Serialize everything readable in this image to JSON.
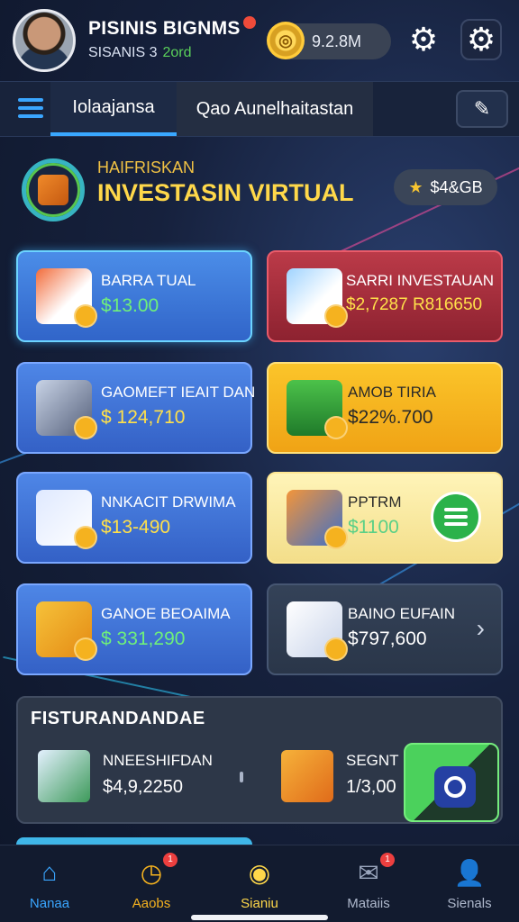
{
  "header": {
    "user_name": "PISINIS BIGNMS",
    "user_sub": "SISANIS 3",
    "user_sub_highlight": "2ord",
    "coin_value": "9.2.8M"
  },
  "tabs": {
    "tab_active": "Iolaajansa",
    "tab_second": "Qao Aunelhaitastan"
  },
  "hero": {
    "kicker": "HAIFRISKAN",
    "title": "INVESTASIN VIRTUAL",
    "badge_value": "$4&GB"
  },
  "cards": [
    {
      "title": "BARRA TUAL",
      "value": "$13.00"
    },
    {
      "title": "SARRI INVESTAUAN",
      "value": "$2,7287 R816650"
    },
    {
      "title": "GAOMEFT IEAIT DAN",
      "value": "$ 124,710"
    },
    {
      "title": "AMOB TIRIA",
      "value": "$22%.700"
    },
    {
      "title": "NNKACIT DRWIMA",
      "value": "$13-490"
    },
    {
      "title": "PPTRM",
      "value": "$1100"
    },
    {
      "title": "GANOE BEOAIMA",
      "value": "$ 331,290"
    },
    {
      "title": "BAINO EUFAIN",
      "value": "$797,600"
    }
  ],
  "featured": {
    "title": "FISTURANDANDAE",
    "items": [
      {
        "title": "NNEESHIFDAN",
        "value": "$4,9,2250"
      },
      {
        "title": "SEGNT",
        "value": "1/3,00"
      }
    ]
  },
  "bottom_nav": {
    "items": [
      {
        "label": "Nanaa"
      },
      {
        "label": "Aaobs",
        "badge": "1"
      },
      {
        "label": "Sianiu"
      },
      {
        "label": "Mataiis",
        "badge": "1"
      },
      {
        "label": "Sienals"
      }
    ]
  },
  "colors": {
    "accent_blue": "#39a7ff",
    "accent_yellow": "#ffd84a",
    "accent_green": "#5ad05a",
    "badge_red": "#ec3f3f"
  }
}
